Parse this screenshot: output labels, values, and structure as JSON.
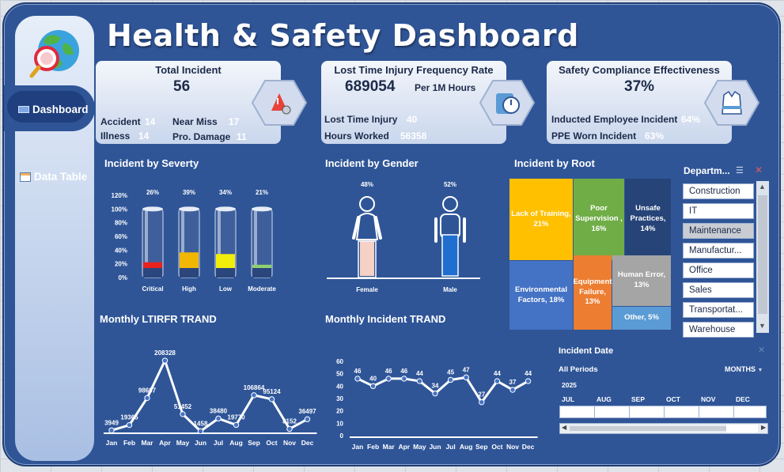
{
  "dashboard": {
    "title": "Health & Safety Dashboard"
  },
  "nav": {
    "dashboard": "Dashboard",
    "data_table": "Data Table"
  },
  "cards": {
    "total": {
      "title": "Total Incident",
      "value": "56",
      "accident_label": "Accident",
      "accident_value": "14",
      "near_miss_label": "Near Miss",
      "near_miss_value": "17",
      "illness_label": "Illness",
      "illness_value": "14",
      "pro_damage_label": "Pro. Damage",
      "pro_damage_value": "11"
    },
    "ltifr": {
      "title": "Lost Time Injury Frequency Rate",
      "value": "689054",
      "unit": "Per 1M Hours",
      "lti_label": "Lost Time Injury",
      "lti_value": "40",
      "hours_label": "Hours Worked",
      "hours_value": "56358"
    },
    "compliance": {
      "title": "Safety Compliance Effectiveness",
      "value": "37%",
      "inducted_label": "Inducted Employee Incident",
      "inducted_value": "64%",
      "ppe_label": "PPE Worn Incident",
      "ppe_value": "63%"
    }
  },
  "sections": {
    "severity": "Incident by Severty",
    "gender": "Incident by Gender",
    "root": "Incident by Root",
    "ltifr_trend": "Monthly LTIRFR TRAND",
    "incident_trend": "Monthly Incident TRAND"
  },
  "severity": {
    "yticks": [
      "120%",
      "100%",
      "80%",
      "60%",
      "40%",
      "20%",
      "0%"
    ],
    "items": [
      {
        "label": "Critical",
        "pct": "26%",
        "fill": 0.07,
        "color": "#e8231e"
      },
      {
        "label": "High",
        "pct": "39%",
        "fill": 0.19,
        "color": "#f2b705"
      },
      {
        "label": "Low",
        "pct": "34%",
        "fill": 0.17,
        "color": "#f1ee0b"
      },
      {
        "label": "Moderate",
        "pct": "21%",
        "fill": 0.04,
        "color": "#8fd16f"
      }
    ]
  },
  "gender": {
    "female": {
      "label": "Female",
      "pct": "48%"
    },
    "male": {
      "label": "Male",
      "pct": "52%"
    }
  },
  "root": [
    {
      "label": "Lack of Training, 21%",
      "color": "#ffc000"
    },
    {
      "label": "Poor Supervision , 16%",
      "color": "#70ad47"
    },
    {
      "label": "Unsafe Practices, 14%",
      "color": "#264478"
    },
    {
      "label": "Environmental Factors, 18%",
      "color": "#4472c4"
    },
    {
      "label": "Equipment Failure, 13%",
      "color": "#ed7d31"
    },
    {
      "label": "Human Error, 13%",
      "color": "#a5a5a5"
    },
    {
      "label": "Other, 5%",
      "color": "#5b9bd5"
    }
  ],
  "slicer": {
    "title": "Departm...",
    "items": [
      "Construction",
      "IT",
      "Maintenance",
      "Manufactur...",
      "Office",
      "Sales",
      "Transportat...",
      "Warehouse"
    ],
    "selected": "Maintenance"
  },
  "timeline": {
    "title": "Incident Date",
    "period": "All Periods",
    "level": "MONTHS",
    "year": "2025",
    "months": [
      "JUL",
      "AUG",
      "SEP",
      "OCT",
      "NOV",
      "DEC"
    ]
  },
  "chart_data": [
    {
      "type": "line",
      "title": "Monthly LTIRFR TRAND",
      "categories": [
        "Jan",
        "Feb",
        "Mar",
        "Apr",
        "May",
        "Jun",
        "Jul",
        "Aug",
        "Sep",
        "Oct",
        "Nov",
        "Dec"
      ],
      "values": [
        3949,
        19365,
        98607,
        208328,
        51452,
        1458,
        38480,
        19770,
        106864,
        95124,
        8152,
        36497
      ],
      "labels": [
        "3949",
        "19365",
        "98607",
        "208328",
        "51452",
        "1458",
        "38480",
        "19770",
        "106864",
        "95124",
        "8152",
        "36497"
      ],
      "ylim": [
        0,
        220000
      ],
      "grid": false
    },
    {
      "type": "line",
      "title": "Monthly Incident TRAND",
      "categories": [
        "Jan",
        "Feb",
        "Mar",
        "Apr",
        "May",
        "Jun",
        "Jul",
        "Aug",
        "Sep",
        "Oct",
        "Nov",
        "Dec"
      ],
      "values": [
        46,
        40,
        46,
        46,
        44,
        34,
        45,
        47,
        27,
        44,
        37,
        44
      ],
      "yticks": [
        "60",
        "50",
        "40",
        "30",
        "20",
        "10",
        "0"
      ],
      "ylim": [
        0,
        60
      ],
      "grid": false
    }
  ]
}
